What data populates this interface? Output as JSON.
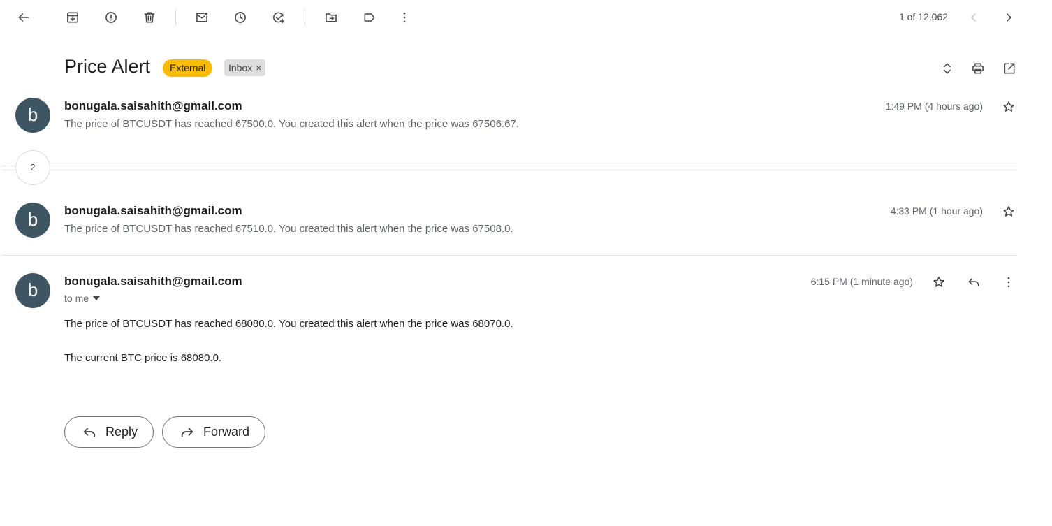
{
  "toolbar": {
    "icons": [
      "back-arrow-icon",
      "archive-icon",
      "report-spam-icon",
      "delete-icon",
      "mark-unread-icon",
      "snooze-icon",
      "add-to-tasks-icon",
      "move-to-icon",
      "label-icon",
      "more-vert-icon"
    ],
    "counter": "1 of 12,062"
  },
  "thread": {
    "subject": "Price Alert",
    "labels": {
      "external": "External",
      "inbox": "Inbox",
      "inbox_remove": "×"
    },
    "collapsed_count": "2"
  },
  "messages": [
    {
      "avatar_letter": "b",
      "sender": "bonugala.saisahith@gmail.com",
      "snippet": "The price of BTCUSDT has reached 67500.0. You created this alert when the price was 67506.67.",
      "time": "1:49 PM (4 hours ago)"
    },
    {
      "avatar_letter": "b",
      "sender": "bonugala.saisahith@gmail.com",
      "snippet": "The price of BTCUSDT has reached 67510.0. You created this alert when the price was 67508.0.",
      "time": "4:33 PM (1 hour ago)"
    },
    {
      "avatar_letter": "b",
      "sender": "bonugala.saisahith@gmail.com",
      "recipient": "to me",
      "time": "6:15 PM (1 minute ago)",
      "body": [
        "The price of BTCUSDT has reached 68080.0. You created this alert when the price was 68070.0.",
        "The current BTC price is 68080.0."
      ]
    }
  ],
  "actions": {
    "reply": "Reply",
    "forward": "Forward"
  },
  "colors": {
    "avatar": "#3e5563",
    "external_chip": "#fbbc04",
    "inbox_chip": "#dddddd"
  }
}
